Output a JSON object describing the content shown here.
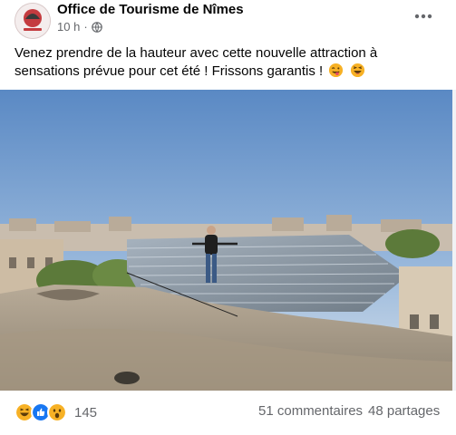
{
  "post": {
    "page_name": "Office de Tourisme de Nîmes",
    "timestamp": "10 h",
    "audience_icon": "globe-icon",
    "more_icon": "more-options-icon",
    "caption": "Venez prendre de la hauteur avec cette nouvelle attraction à sensations prévue pour cet été ! Frissons garantis !",
    "caption_emojis": [
      "winking-tongue-emoji",
      "laughing-emoji"
    ],
    "photo_icon": "tightrope-walker-photo"
  },
  "footer": {
    "reaction_icons": [
      "haha-reaction-icon",
      "like-reaction-icon",
      "wow-reaction-icon"
    ],
    "reaction_count": "145",
    "comments": "51 commentaires",
    "shares": "48 partages"
  },
  "colors": {
    "like_blue": "#1877f2",
    "haha_yellow": "#f7b125",
    "secondary_text": "#65676b"
  }
}
